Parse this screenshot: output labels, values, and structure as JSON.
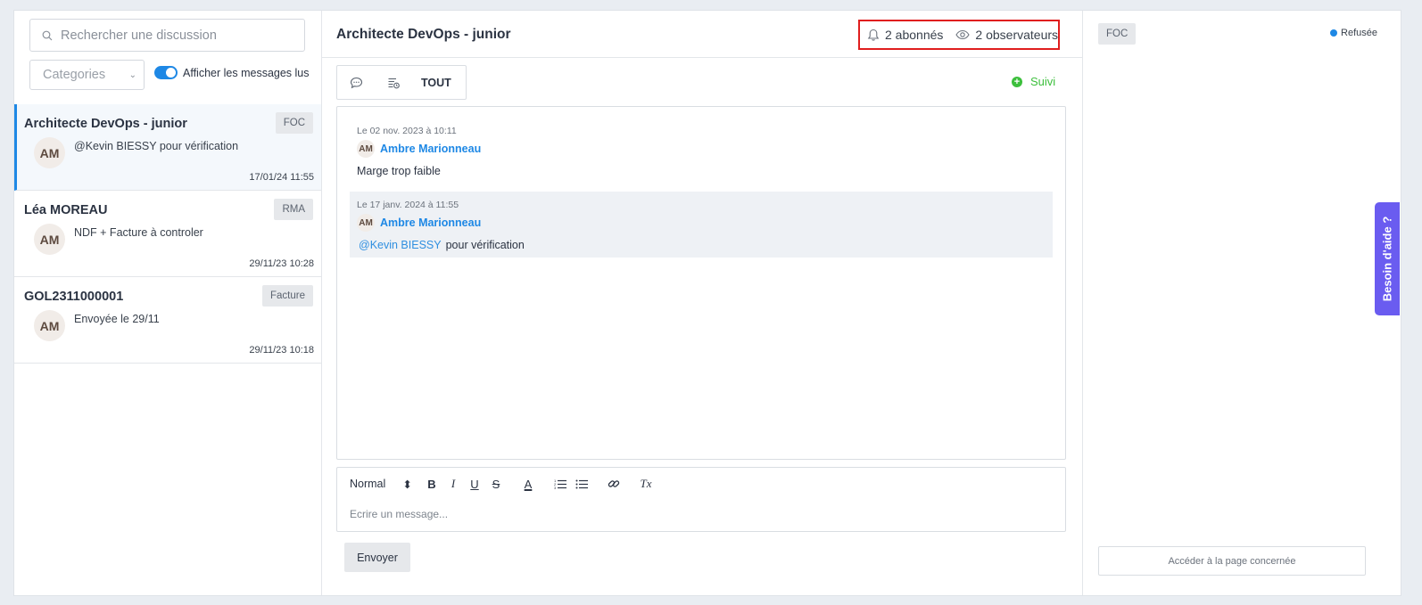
{
  "search": {
    "placeholder": "Rechercher une discussion"
  },
  "filters": {
    "category_placeholder": "Categories",
    "toggle_label": "Afficher les messages lus",
    "toggle_on": true
  },
  "conversations": [
    {
      "title": "Architecte DevOps - junior",
      "tag": "FOC",
      "avatar": "AM",
      "snippet": "@Kevin BIESSY pour vérification",
      "date": "17/01/24 11:55",
      "active": true
    },
    {
      "title": "Léa MOREAU",
      "tag": "RMA",
      "avatar": "AM",
      "snippet": "NDF + Facture à controler",
      "date": "29/11/23 10:28",
      "active": false
    },
    {
      "title": "GOL2311000001",
      "tag": "Facture",
      "avatar": "AM",
      "snippet": "Envoyée le 29/11",
      "date": "29/11/23 10:18",
      "active": false
    }
  ],
  "thread": {
    "title": "Architecte DevOps - junior",
    "subscribers": "2 abonnés",
    "observers": "2 observateurs",
    "tab_all": "TOUT",
    "follow_label": "Suivi",
    "messages": [
      {
        "date": "Le 02 nov. 2023 à 10:11",
        "avatar": "AM",
        "author": "Ambre Marionneau",
        "mention": "",
        "text": "Marge trop faible"
      },
      {
        "date": "Le 17 janv. 2024 à 11:55",
        "avatar": "AM",
        "author": "Ambre Marionneau",
        "mention": "@Kevin BIESSY",
        "text": "pour vérification"
      }
    ]
  },
  "editor": {
    "format_select": "Normal",
    "format_arrows": "⬍",
    "bold": "B",
    "italic": "I",
    "underline": "U",
    "strike": "S",
    "color": "A",
    "clear": "Tx",
    "placeholder": "Ecrire un message...",
    "send_label": "Envoyer"
  },
  "details": {
    "tag": "FOC",
    "status": "Refusée",
    "status_color": "#1e88e5",
    "goto_label": "Accéder à la page concernée"
  },
  "help": {
    "label": "Besoin d'aide ?",
    "color": "#6a5cf0"
  },
  "colors": {
    "accent": "#1e88e5",
    "follow": "#3cbf3c",
    "highlight_border": "#e01e1e"
  }
}
